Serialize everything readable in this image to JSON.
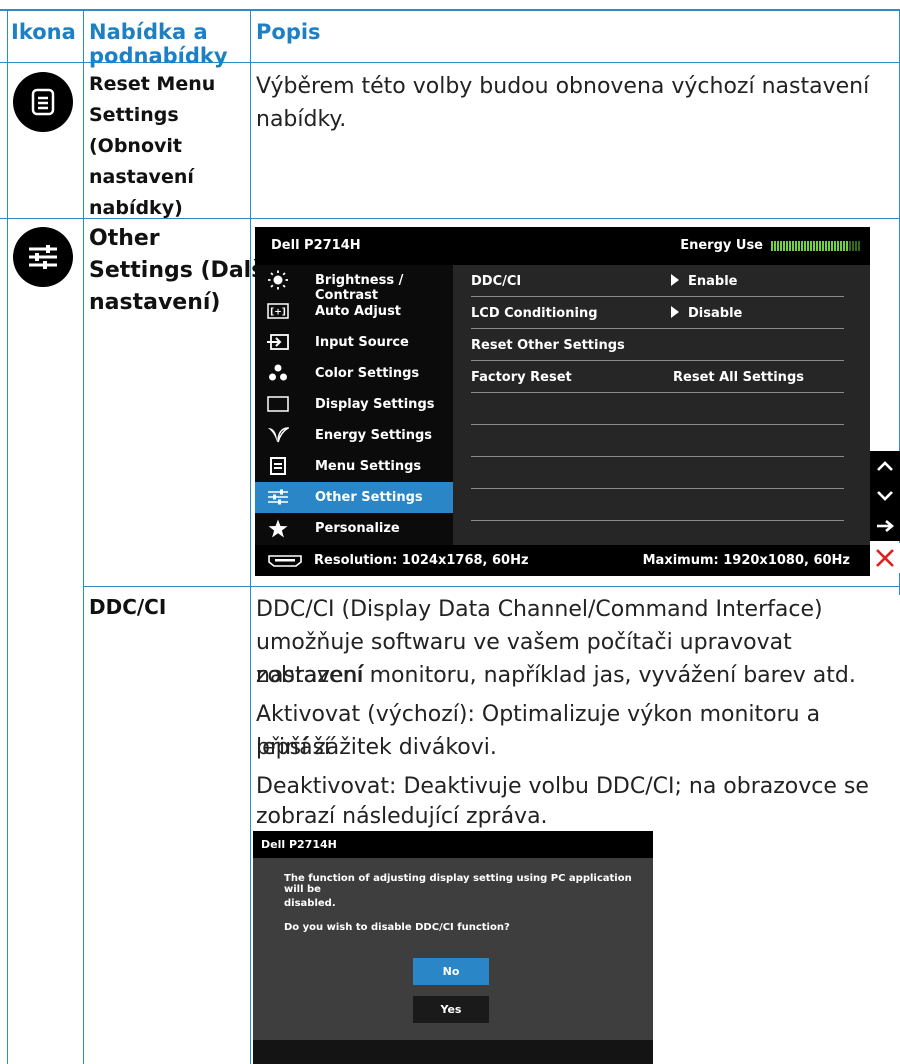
{
  "header": {
    "col1": "Ikona",
    "col2_line1": "Nabídka a",
    "col2_line2": "podnabídky",
    "col3": "Popis"
  },
  "rows": {
    "reset": {
      "icon": "menu-doc-icon",
      "name_lines": [
        "Reset Menu",
        "Settings",
        "(Obnovit",
        "nastavení",
        "nabídky)"
      ],
      "desc_lines": [
        "Výběrem této volby budou obnovena výchozí nastavení",
        "nabídky."
      ]
    },
    "other": {
      "icon": "sliders-icon",
      "name_lines": [
        "Other",
        "Settings (Další",
        "nastavení)"
      ]
    },
    "ddc": {
      "name": "DDC/CI",
      "desc_lines": [
        "DDC/CI (Display Data Channel/Command Interface)",
        "umožňuje softwaru ve vašem počítači upravovat nastavení",
        "zobrazení monitoru, například jas, vyvážení barev atd.",
        "Aktivovat (výchozí): Optimalizuje výkon monitoru a přináší",
        "lepší zážitek divákovi.",
        "Deaktivovat: Deaktivuje volbu DDC/CI; na obrazovce se",
        "zobrazí následující zpráva."
      ]
    }
  },
  "osd": {
    "title": "Dell P2714H",
    "energy_label": "Energy Use",
    "energy_level": 0.85,
    "menu": [
      {
        "label": "Brightness / Contrast",
        "icon": "brightness-icon"
      },
      {
        "label": "Auto Adjust",
        "icon": "auto-adjust-icon"
      },
      {
        "label": "Input Source",
        "icon": "input-source-icon"
      },
      {
        "label": "Color Settings",
        "icon": "color-dots-icon"
      },
      {
        "label": "Display Settings",
        "icon": "display-icon"
      },
      {
        "label": "Energy Settings",
        "icon": "leaf-icon"
      },
      {
        "label": "Menu Settings",
        "icon": "menu-icon"
      },
      {
        "label": "Other Settings",
        "icon": "sliders-icon",
        "selected": true
      },
      {
        "label": "Personalize",
        "icon": "star-icon"
      }
    ],
    "options": [
      {
        "label": "DDC/CI",
        "value": "Enable"
      },
      {
        "label": "LCD Conditioning",
        "value": "Disable"
      },
      {
        "label": "Reset Other Settings",
        "value": ""
      },
      {
        "label": "Factory Reset",
        "value": "Reset All Settings"
      }
    ],
    "resolution": "Resolution: 1024x1768, 60Hz",
    "maximum": "Maximum: 1920x1080, 60Hz",
    "nav": [
      "up-arrow-icon",
      "down-arrow-icon",
      "right-arrow-icon",
      "close-icon"
    ]
  },
  "dialog": {
    "title": "Dell P2714H",
    "line1": "The function of adjusting display setting using PC application will be",
    "line2": "disabled.",
    "line3": "Do you wish to disable DDC/CI function?",
    "no": "No",
    "yes": "Yes"
  },
  "colors": {
    "accent": "#1d7fc4",
    "border": "#2e8bc9",
    "selected": "#2a86c6",
    "energy": "#6ed33c",
    "close": "#e02020"
  }
}
